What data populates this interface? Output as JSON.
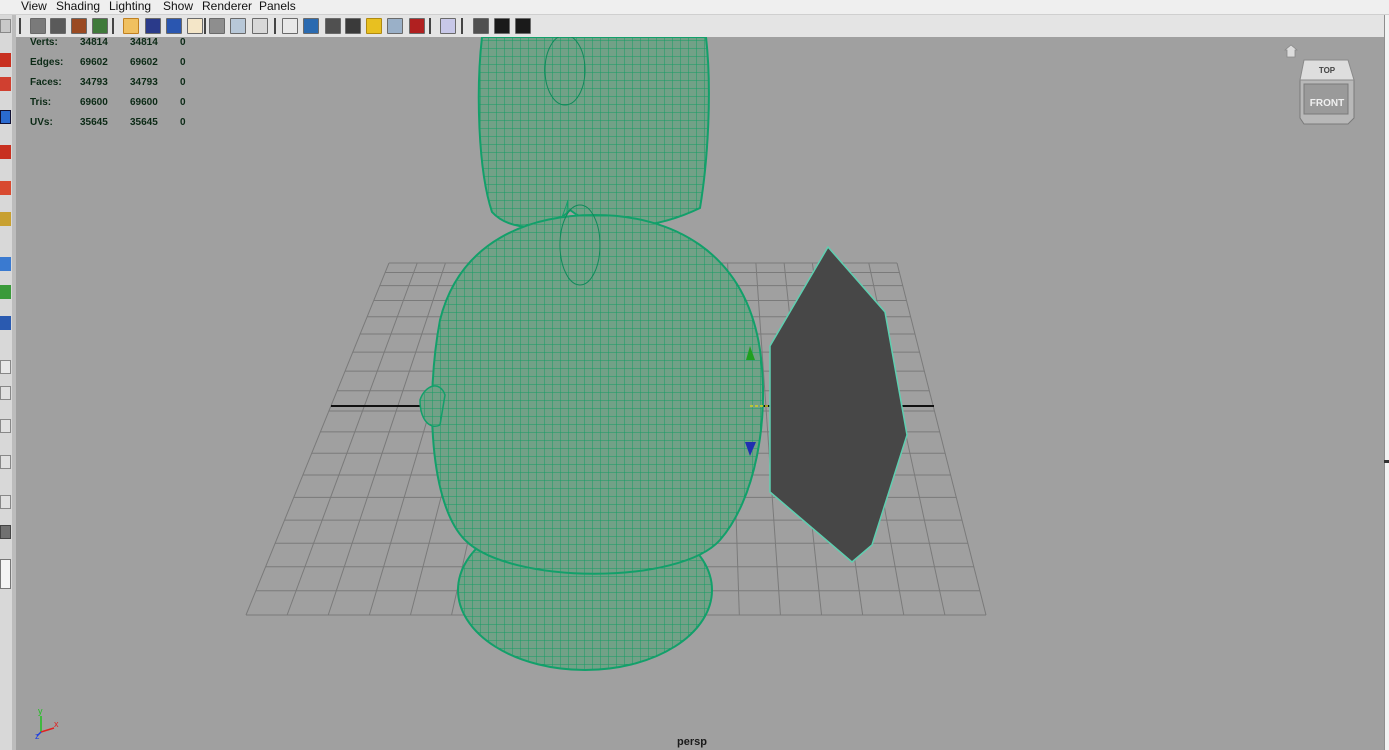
{
  "menu": [
    "View",
    "Shading",
    "Lighting",
    "Show",
    "Renderer",
    "Panels"
  ],
  "hud": [
    {
      "label": "Verts:",
      "v1": "34814",
      "v2": "34814",
      "v3": "0"
    },
    {
      "label": "Edges:",
      "v1": "69602",
      "v2": "69602",
      "v3": "0"
    },
    {
      "label": "Faces:",
      "v1": "34793",
      "v2": "34793",
      "v3": "0"
    },
    {
      "label": "Tris:",
      "v1": "69600",
      "v2": "69600",
      "v3": "0"
    },
    {
      "label": "UVs:",
      "v1": "35645",
      "v2": "35645",
      "v3": "0"
    }
  ],
  "viewcube": {
    "top": "TOP",
    "front": "FRONT"
  },
  "camera_label": "persp",
  "axes": {
    "y": "y",
    "x": "x",
    "z": "z"
  },
  "colors": {
    "viewport_bg": "#a0a0a0",
    "wireframe": "#12a06a",
    "mesh_fill": "#6f9e83",
    "plane_fill": "#474747",
    "grid": "#7a7a7a"
  },
  "toolbar_icons": [
    "camera-select-icon",
    "camera-attributes-icon",
    "bookmark-icon",
    "image-plane-icon",
    "grid-toggle-icon",
    "film-gate-icon",
    "resolution-gate-icon",
    "gate-mask-icon",
    "field-chart-icon",
    "safe-action-icon",
    "safe-title-icon",
    "wireframe-icon",
    "smooth-shade-icon",
    "wireframe-on-shaded-icon",
    "textured-icon",
    "use-all-lights-icon",
    "shadows-icon",
    "ambient-occlusion-icon",
    "isolate-select-icon",
    "xray-icon",
    "xray-joints-icon",
    "xray-components-icon"
  ],
  "left_tools": [
    "select-tool-icon",
    "lasso-tool-icon",
    "paint-select-icon",
    "move-tool-icon",
    "rotate-tool-icon",
    "scale-tool-icon",
    "universal-manipulator-icon",
    "soft-mod-icon",
    "show-manipulator-icon",
    "last-tool-icon"
  ]
}
